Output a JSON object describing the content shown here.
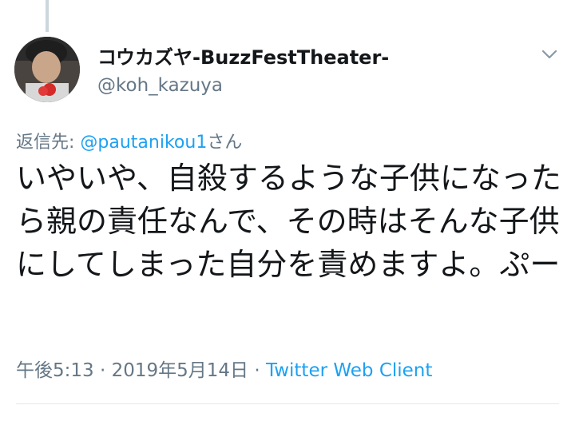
{
  "tweet": {
    "author": {
      "display_name": "コウカズヤ-BuzzFestTheater-",
      "handle": "@koh_kazuya"
    },
    "reply_prefix": "返信先: ",
    "reply_mention": "@pautanikou1",
    "reply_suffix": "さん",
    "text": "いやいや、自殺するような子供になったら親の責任なんで、その時はそんな子供にしてしまった自分を責めますよ。ぷー",
    "time": "午後5:13",
    "separator": " · ",
    "date": "2019年5月14日",
    "client": "Twitter Web Client"
  },
  "icons": {
    "menu": "chevron-down-icon",
    "avatar": "profile-avatar"
  },
  "colors": {
    "link": "#1da1f2",
    "secondary_text": "#657786",
    "primary_text": "#14171a",
    "divider": "#e1e8ed"
  }
}
